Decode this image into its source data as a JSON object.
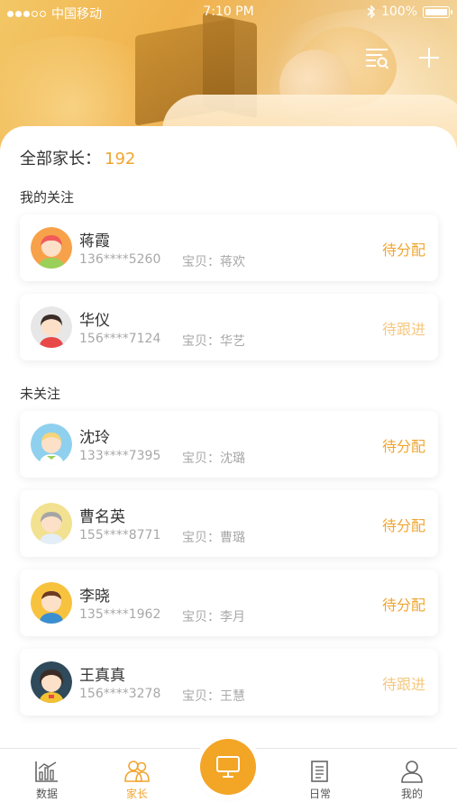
{
  "status_bar": {
    "carrier": "中国移动",
    "time": "7:10 PM",
    "battery": "100%"
  },
  "header": {
    "filter_icon": "filter-list-icon",
    "add_icon": "plus-icon"
  },
  "summary": {
    "label": "全部家长：",
    "count": "192"
  },
  "sections": {
    "followed_title": "我的关注",
    "unfollowed_title": "未关注"
  },
  "followed": [
    {
      "name": "蒋霞",
      "phone": "136****5260",
      "baby": "宝贝：蒋欢",
      "status": "待分配"
    },
    {
      "name": "华仪",
      "phone": "156****7124",
      "baby": "宝贝：华艺",
      "status": "待跟进"
    }
  ],
  "unfollowed": [
    {
      "name": "沈玲",
      "phone": "133****7395",
      "baby": "宝贝：沈璐",
      "status": "待分配"
    },
    {
      "name": "曹名英",
      "phone": "155****8771",
      "baby": "宝贝：曹璐",
      "status": "待分配"
    },
    {
      "name": "李晓",
      "phone": "135****1962",
      "baby": "宝贝：李月",
      "status": "待分配"
    },
    {
      "name": "王真真",
      "phone": "156****3278",
      "baby": "宝贝：王慧",
      "status": "待跟进"
    }
  ],
  "tabs": [
    {
      "label": "数据",
      "icon": "bar-chart-icon"
    },
    {
      "label": "家长",
      "icon": "parents-icon"
    },
    {
      "label": "",
      "icon": "monitor-icon"
    },
    {
      "label": "日常",
      "icon": "document-icon"
    },
    {
      "label": "我的",
      "icon": "person-icon"
    }
  ],
  "colors": {
    "accent": "#f0a530",
    "follow": "#f6c780",
    "muted": "#a8a8a8"
  }
}
